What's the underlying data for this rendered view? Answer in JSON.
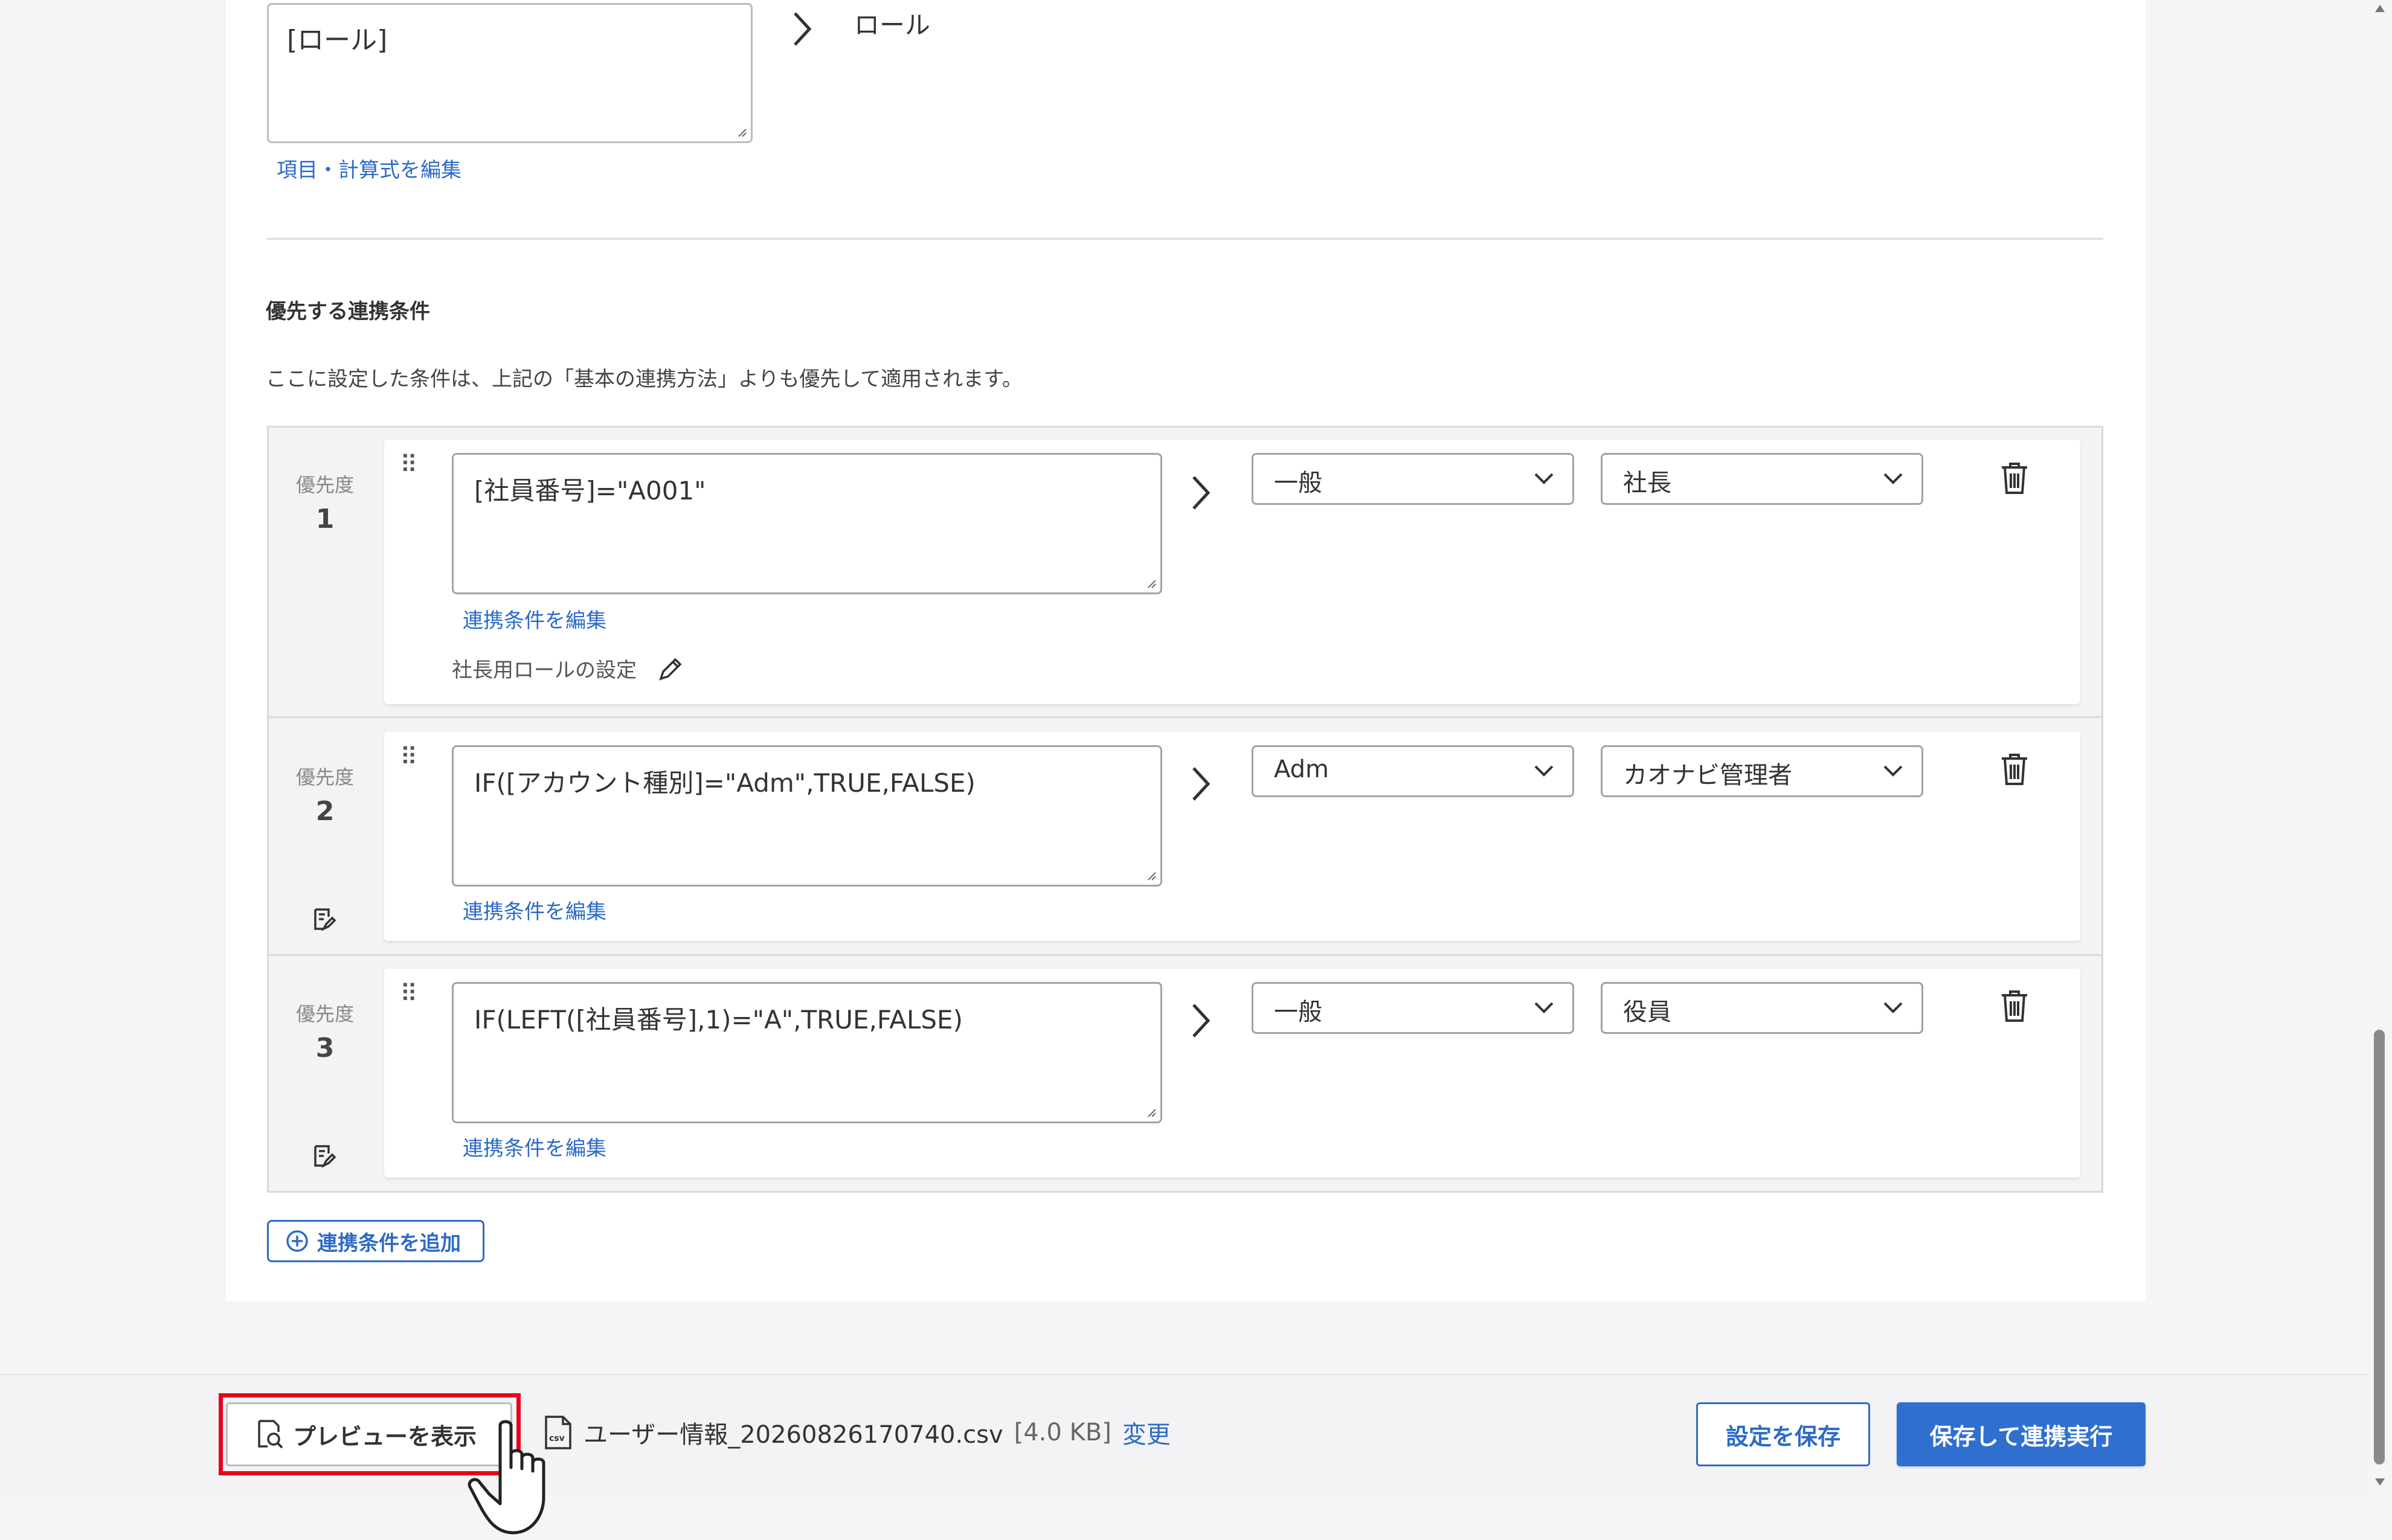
{
  "role_mapping": {
    "formula_value": "[ロール]",
    "edit_link": "項目・計算式を編集",
    "target_label": "ロール"
  },
  "priority_section": {
    "title": "優先する連携条件",
    "description": "ここに設定した条件は、上記の「基本の連携方法」よりも優先して適用されます。",
    "priority_label": "優先度",
    "edit_condition_link": "連携条件を編集",
    "rules": [
      {
        "priority": "1",
        "condition": "[社員番号]=\"A001\"",
        "select_1": "一般",
        "select_2": "社長",
        "note": "社長用ロールの設定"
      },
      {
        "priority": "2",
        "condition": "IF([アカウント種別]=\"Adm\",TRUE,FALSE)",
        "select_1": "Adm",
        "select_2": "カオナビ管理者"
      },
      {
        "priority": "3",
        "condition": "IF(LEFT([社員番号],1)=\"A\",TRUE,FALSE)",
        "select_1": "一般",
        "select_2": "役員"
      }
    ],
    "add_button": "連携条件を追加"
  },
  "footer": {
    "preview_button": "プレビューを表示",
    "file_name": "ユーザー情報_20260826170740.csv",
    "file_size": "[4.0 KB]",
    "change_link": "変更",
    "save_button": "設定を保存",
    "save_run_button": "保存して連携実行"
  },
  "colors": {
    "accent": "#2d6bc6",
    "primary_button": "#2f6fd0",
    "highlight": "#e8001c"
  }
}
